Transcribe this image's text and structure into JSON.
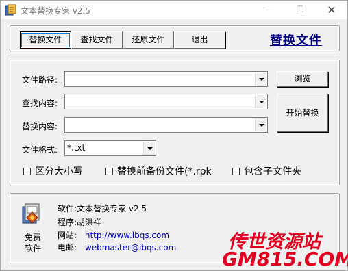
{
  "window": {
    "title": "文本替换专家 v2.5"
  },
  "toolbar": {
    "buttons": [
      {
        "label": "替换文件",
        "active": true
      },
      {
        "label": "查找文件",
        "active": false
      },
      {
        "label": "还原文件",
        "active": false
      },
      {
        "label": "退出",
        "active": false
      }
    ],
    "heading": "替换文件"
  },
  "form": {
    "file_path_label": "文件路径:",
    "file_path_value": "",
    "find_label": "查找内容:",
    "find_value": "",
    "replace_label": "替换内容:",
    "replace_value": "",
    "format_label": "文件格式:",
    "format_value": "*.txt",
    "browse_label": "浏览",
    "start_label": "开始替换"
  },
  "options": {
    "case_label": "区分大小写",
    "case_checked": false,
    "backup_label": "替换前备份文件(*.rpk",
    "backup_checked": false,
    "subfolder_label": "包含子文件夹",
    "subfolder_checked": false
  },
  "info": {
    "free_label": "免费软件",
    "software": "软件:文本替换专家 v2.5",
    "author": "程序:胡洪祥",
    "website_label": "网站:",
    "website_url": "http://www.ibqs.com",
    "email_label": "电邮:",
    "email": "webmaster@ibqs.com"
  },
  "watermark": {
    "line1": "传世资源站",
    "line2": "GM815.COM"
  }
}
